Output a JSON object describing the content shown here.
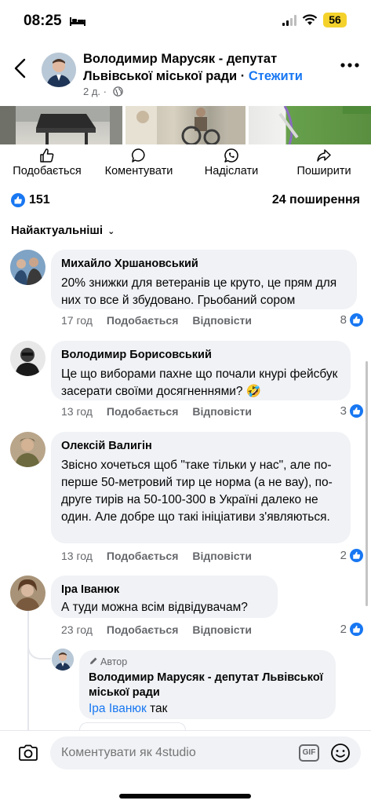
{
  "status_bar": {
    "time": "08:25",
    "battery": "56"
  },
  "header": {
    "page_name": "Володимир Марусяк - депутат Львівської міської ради",
    "separator": " · ",
    "follow": "Стежити",
    "post_age": "2 д. ·"
  },
  "actions": {
    "like": "Подобається",
    "comment": "Коментувати",
    "send": "Надіслати",
    "share": "Поширити"
  },
  "reactions": {
    "likes": "151",
    "shares": "24 поширення"
  },
  "sort": {
    "label": "Найактуальніші"
  },
  "comment_actions": {
    "like": "Подобається",
    "reply": "Відповісти"
  },
  "comments": [
    {
      "author": "Михайло Хршановський",
      "text": "20% знижки для ветеранів це круто, це прям для них то все й збудовано. Грьобаний сором",
      "time": "17 год",
      "likes": "8"
    },
    {
      "author": "Володимир Борисовський",
      "text": "Це що виборами пахне що почали кнурі фейсбук засерати своїми досягненнями? 🤣",
      "time": "13 год",
      "likes": "3"
    },
    {
      "author": "Олексій Валигін",
      "text": "Звісно хочеться щоб \"таке тільки у нас\", але по-перше 50-метровий тир це норма (а не вау), по-друге тирів на 50-100-300 в Україні далеко не один. Але добре що такі ініціативи з'являються.",
      "time": "13 год",
      "likes": "2"
    },
    {
      "author": "Іра Іванюк",
      "text": "А туди можна всім відвідувачам?",
      "time": "23 год",
      "likes": "2"
    }
  ],
  "reply": {
    "badge": "Автор",
    "author": "Володимир Марусяк - депутат Львівської міської ради",
    "mention": "Іра Іванюк",
    "text": " так"
  },
  "composer": {
    "placeholder": "Коментувати як 4studio",
    "gif": "GIF"
  },
  "colors": {
    "accent": "#1877f2",
    "bubble": "#f0f2f5",
    "meta": "#65676b"
  }
}
